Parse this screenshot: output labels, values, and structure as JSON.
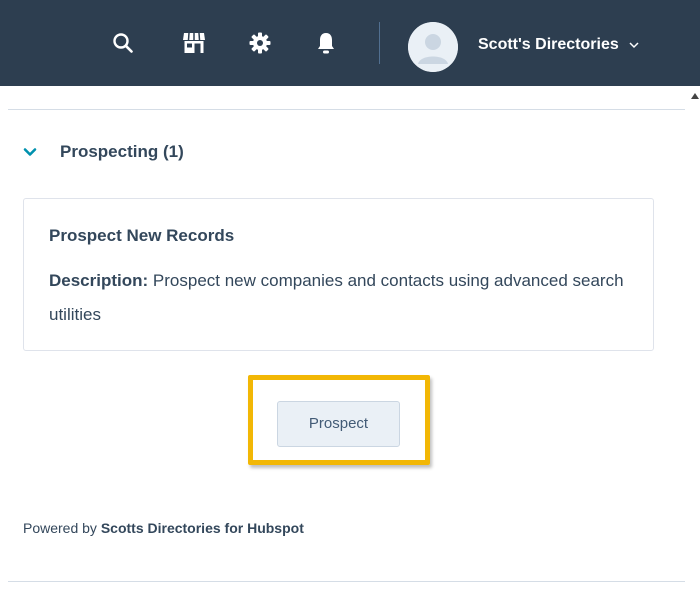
{
  "topbar": {
    "background": "#2d3e50",
    "icons": [
      "search-icon",
      "marketplace-icon",
      "settings-gear-icon",
      "notifications-bell-icon"
    ],
    "account_name": "Scott's Directories",
    "account_chevron": "chevron-down-icon"
  },
  "section": {
    "title": "Prospecting (1)",
    "chevron_color": "#0091ae"
  },
  "card": {
    "title": "Prospect New Records",
    "description_label": "Description:",
    "description_text": "Prospect new companies and contacts using advanced search utilities"
  },
  "action": {
    "button_label": "Prospect",
    "highlight_color": "#f2b705"
  },
  "footer": {
    "powered_prefix": "Powered by",
    "powered_brand": "Scotts Directories for Hubspot"
  }
}
